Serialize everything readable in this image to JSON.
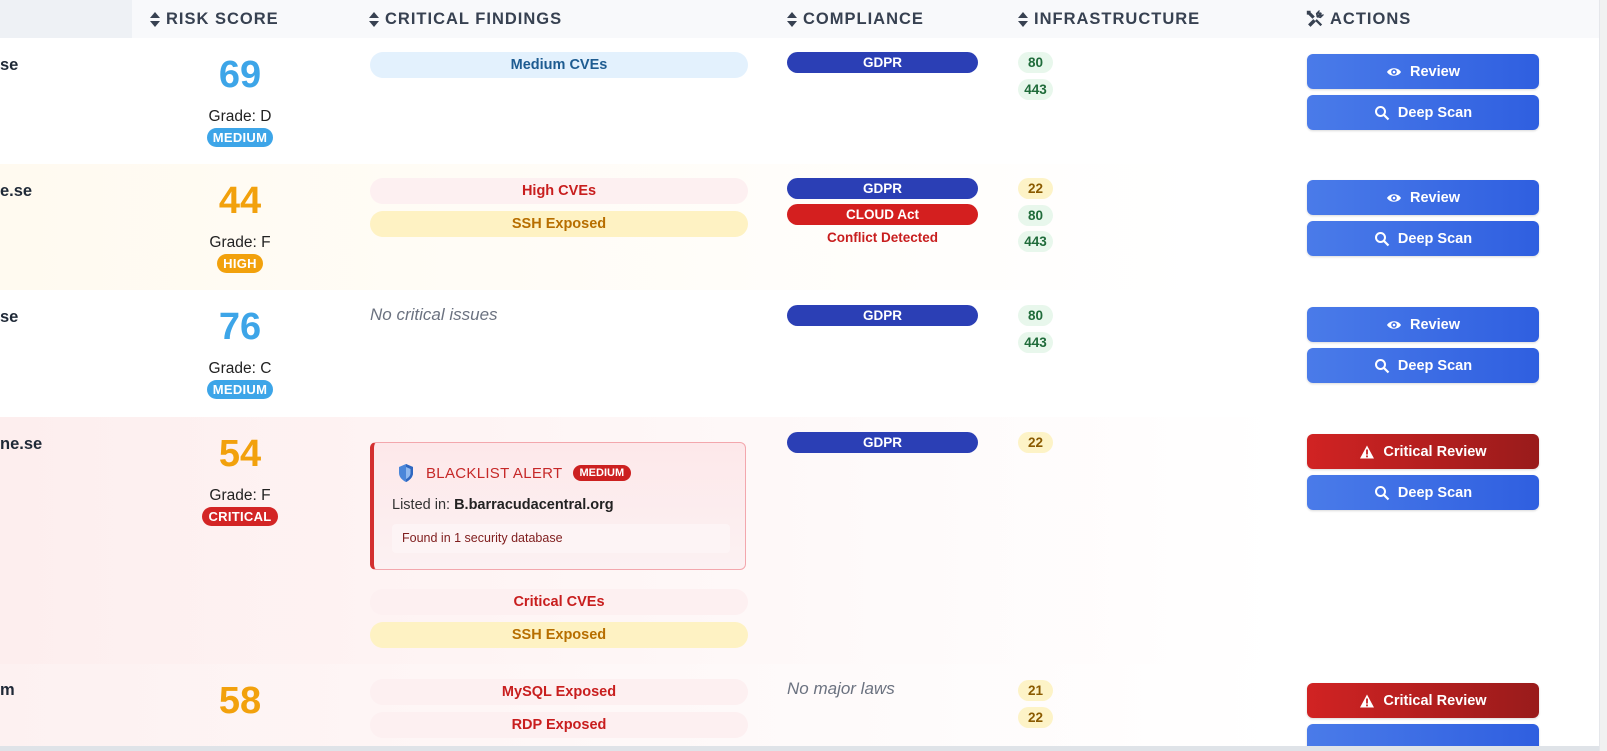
{
  "headers": {
    "risk_score": "RISK SCORE",
    "critical_findings": "CRITICAL FINDINGS",
    "compliance": "COMPLIANCE",
    "infrastructure": "INFRASTRUCTURE",
    "actions": "ACTIONS"
  },
  "labels": {
    "review": "Review",
    "deep_scan": "Deep Scan",
    "critical_review": "Critical Review",
    "no_critical_issues": "No critical issues",
    "no_major_laws": "No major laws",
    "conflict_detected": "Conflict Detected"
  },
  "colors": {
    "medium": "#3da5e8",
    "high": "#f2a10c",
    "critical": "#d32525",
    "gdpr": "#2b3fb5",
    "primary_button": "#3b6ce7",
    "danger_button": "#c62020"
  },
  "rows": [
    {
      "domain": "se",
      "score": "69",
      "grade": "Grade: D",
      "level": "MEDIUM",
      "findings": [
        "Medium CVEs"
      ],
      "compliance": [
        "GDPR"
      ],
      "ports": [
        "80",
        "443"
      ],
      "primary_action": "Review"
    },
    {
      "domain": "e.se",
      "score": "44",
      "grade": "Grade: F",
      "level": "HIGH",
      "findings": [
        "High CVEs",
        "SSH Exposed"
      ],
      "compliance": [
        "GDPR",
        "CLOUD Act"
      ],
      "compliance_note": "Conflict Detected",
      "ports": [
        "22",
        "80",
        "443"
      ],
      "primary_action": "Review"
    },
    {
      "domain": "se",
      "score": "76",
      "grade": "Grade: C",
      "level": "MEDIUM",
      "findings_note": "No critical issues",
      "compliance": [
        "GDPR"
      ],
      "ports": [
        "80",
        "443"
      ],
      "primary_action": "Review"
    },
    {
      "domain": "ne.se",
      "score": "54",
      "grade": "Grade: F",
      "level": "CRITICAL",
      "blacklist": {
        "title": "BLACKLIST ALERT",
        "badge": "MEDIUM",
        "listed_prefix": "Listed in: ",
        "listed_in": "B.barracudacentral.org",
        "found": "Found in 1 security database",
        "icon": "shield-icon"
      },
      "findings": [
        "Critical CVEs",
        "SSH Exposed"
      ],
      "compliance": [
        "GDPR"
      ],
      "ports": [
        "22"
      ],
      "primary_action": "Critical Review"
    },
    {
      "domain": "m",
      "score": "58",
      "findings": [
        "MySQL Exposed",
        "RDP Exposed"
      ],
      "compliance_note": "No major laws",
      "ports": [
        "21",
        "22"
      ],
      "primary_action": "Critical Review"
    }
  ]
}
